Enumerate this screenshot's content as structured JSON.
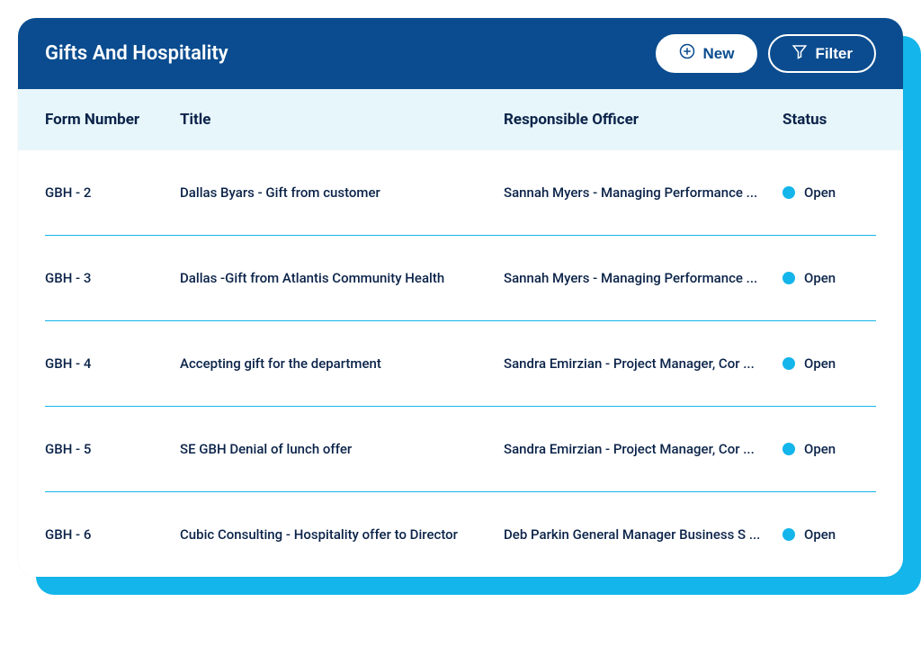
{
  "header": {
    "title": "Gifts And Hospitality",
    "new_label": "New",
    "filter_label": "Filter"
  },
  "columns": {
    "form": "Form Number",
    "title": "Title",
    "officer": "Responsible Officer",
    "status": "Status"
  },
  "rows": [
    {
      "form": "GBH - 2",
      "title": "Dallas Byars - Gift from customer",
      "officer": "Sannah Myers - Managing Performance ...",
      "status": "Open"
    },
    {
      "form": "GBH - 3",
      "title": "Dallas -Gift from Atlantis Community Health",
      "officer": "Sannah Myers - Managing Performance ...",
      "status": "Open"
    },
    {
      "form": "GBH - 4",
      "title": "Accepting gift for the department",
      "officer": "Sandra Emirzian - Project Manager, Cor ...",
      "status": "Open"
    },
    {
      "form": "GBH - 5",
      "title": "SE GBH Denial of lunch offer",
      "officer": "Sandra Emirzian - Project Manager, Cor ...",
      "status": "Open"
    },
    {
      "form": "GBH - 6",
      "title": "Cubic Consulting - Hospitality offer to Director",
      "officer": "Deb Parkin General Manager Business S ...",
      "status": "Open"
    }
  ]
}
